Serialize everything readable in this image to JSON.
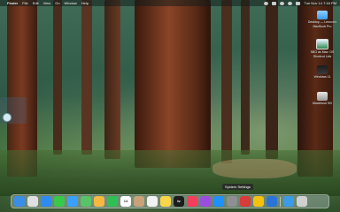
{
  "menubar": {
    "apple_glyph": "",
    "app_name": "Finder",
    "menus": [
      "File",
      "Edit",
      "View",
      "Go",
      "Window",
      "Help"
    ],
    "clock": "Tue Nov 14  7:18 PM"
  },
  "desktop": {
    "items": [
      {
        "label": "Desktop — Lenovo's MacBook Pro",
        "icon": "folder-icon"
      },
      {
        "label": "SBG as Mac: OS Shortcut Link",
        "icon": "virtual-machine-icon"
      },
      {
        "label": "Windows 11",
        "icon": "windows-vm-icon"
      },
      {
        "label": "Macintosh HD",
        "icon": "hard-drive-icon"
      }
    ]
  },
  "tooltip": "System Settings",
  "dock": {
    "apps": [
      {
        "name": "Finder",
        "icon": "finder-icon",
        "color": "#3a8ee6"
      },
      {
        "name": "Launchpad",
        "icon": "launchpad-icon",
        "color": "#e0e0e0"
      },
      {
        "name": "Safari",
        "icon": "safari-icon",
        "color": "#2d8cf0"
      },
      {
        "name": "Messages",
        "icon": "messages-icon",
        "color": "#38c94a"
      },
      {
        "name": "Mail",
        "icon": "mail-icon",
        "color": "#3aa0ff"
      },
      {
        "name": "Maps",
        "icon": "maps-icon",
        "color": "#59c36a"
      },
      {
        "name": "Photos",
        "icon": "photos-icon",
        "color": "#f5b942"
      },
      {
        "name": "FaceTime",
        "icon": "facetime-icon",
        "color": "#2fbf55"
      },
      {
        "name": "Calendar",
        "icon": "calendar-icon",
        "color": "#ffffff",
        "text": "14"
      },
      {
        "name": "Contacts",
        "icon": "contacts-icon",
        "color": "#c9a27a"
      },
      {
        "name": "Reminders",
        "icon": "reminders-icon",
        "color": "#f2f2f2"
      },
      {
        "name": "Notes",
        "icon": "notes-icon",
        "color": "#f7d64a"
      },
      {
        "name": "TV",
        "icon": "tv-icon",
        "color": "#1c1c1c",
        "text": "tv"
      },
      {
        "name": "Music",
        "icon": "music-icon",
        "color": "#f43e5c"
      },
      {
        "name": "Podcasts",
        "icon": "podcasts-icon",
        "color": "#9b4de0"
      },
      {
        "name": "App Store",
        "icon": "app-store-icon",
        "color": "#1e90ff"
      },
      {
        "name": "System Settings",
        "icon": "gear-icon",
        "color": "#8e8e93"
      },
      {
        "name": "Parallels",
        "icon": "parallels-icon",
        "color": "#d93a3a"
      },
      {
        "name": "Chrome",
        "icon": "chrome-icon",
        "color": "#f4c20d"
      },
      {
        "name": "Xcode",
        "icon": "xcode-icon",
        "color": "#2a74d8"
      }
    ],
    "right": [
      {
        "name": "Downloads",
        "icon": "downloads-folder-icon",
        "color": "#3b9be8"
      },
      {
        "name": "Trash",
        "icon": "trash-icon",
        "color": "#d0d0d0"
      }
    ]
  }
}
